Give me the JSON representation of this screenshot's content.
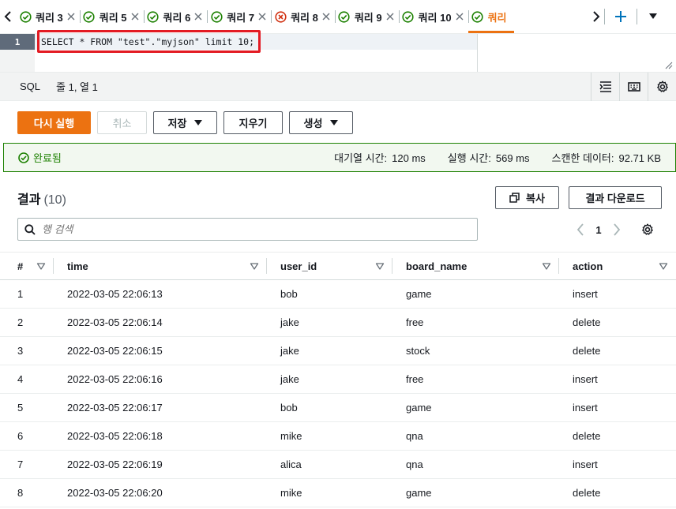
{
  "tabs": [
    {
      "label": "쿼리 3",
      "status": "success"
    },
    {
      "label": "쿼리 5",
      "status": "success"
    },
    {
      "label": "쿼리 6",
      "status": "success"
    },
    {
      "label": "쿼리 7",
      "status": "success"
    },
    {
      "label": "쿼리 8",
      "status": "error"
    },
    {
      "label": "쿼리 9",
      "status": "success"
    },
    {
      "label": "쿼리 10",
      "status": "success"
    },
    {
      "label": "쿼리",
      "status": "success",
      "active": true
    }
  ],
  "editor": {
    "line_number": "1",
    "code": "SELECT * FROM \"test\".\"myjson\" limit 10;"
  },
  "status_bar": {
    "language": "SQL",
    "cursor": "줄 1, 열 1"
  },
  "buttons": {
    "run_again": "다시 실행",
    "cancel": "취소",
    "save": "저장",
    "clear": "지우기",
    "create": "생성"
  },
  "banner": {
    "status": "완료됨",
    "queue_label": "대기열 시간:",
    "queue_value": "120 ms",
    "exec_label": "실행 시간:",
    "exec_value": "569 ms",
    "scanned_label": "스캔한 데이터:",
    "scanned_value": "92.71 KB"
  },
  "results": {
    "title": "결과",
    "count": "(10)",
    "copy": "복사",
    "download": "결과 다운로드",
    "search_placeholder": "행 검색",
    "page": "1"
  },
  "table": {
    "columns": [
      "#",
      "time",
      "user_id",
      "board_name",
      "action"
    ],
    "rows": [
      [
        "1",
        "2022-03-05 22:06:13",
        "bob",
        "game",
        "insert"
      ],
      [
        "2",
        "2022-03-05 22:06:14",
        "jake",
        "free",
        "delete"
      ],
      [
        "3",
        "2022-03-05 22:06:15",
        "jake",
        "stock",
        "delete"
      ],
      [
        "4",
        "2022-03-05 22:06:16",
        "jake",
        "free",
        "insert"
      ],
      [
        "5",
        "2022-03-05 22:06:17",
        "bob",
        "game",
        "insert"
      ],
      [
        "6",
        "2022-03-05 22:06:18",
        "mike",
        "qna",
        "delete"
      ],
      [
        "7",
        "2022-03-05 22:06:19",
        "alica",
        "qna",
        "insert"
      ],
      [
        "8",
        "2022-03-05 22:06:20",
        "mike",
        "game",
        "delete"
      ]
    ]
  },
  "colors": {
    "accent": "#ec7211",
    "success": "#1d8102",
    "error": "#d13212",
    "highlight_box": "#e31b23"
  }
}
